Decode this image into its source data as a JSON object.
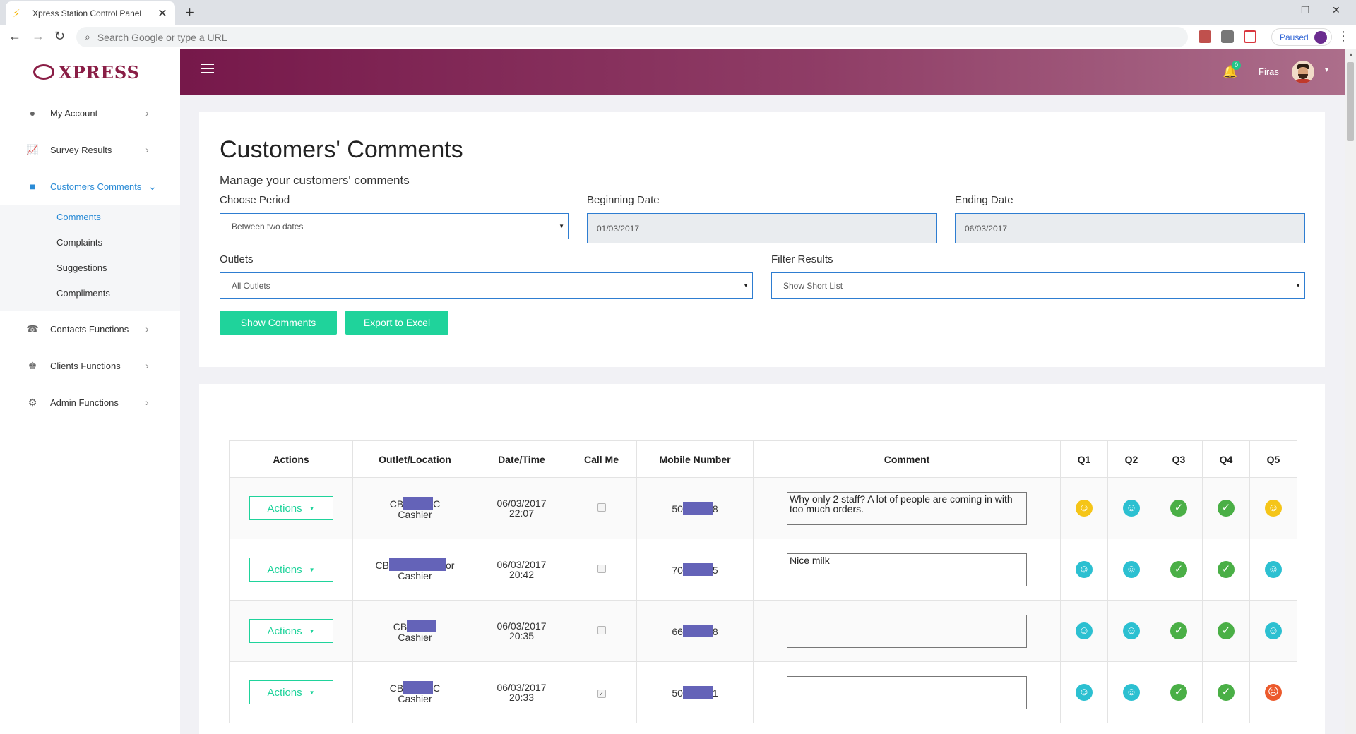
{
  "browser": {
    "tab_title": "Xpress Station Control Panel",
    "tab_close": "✕",
    "new_tab": "+",
    "omnibox_placeholder": "Search Google or type a URL",
    "profile_status": "Paused"
  },
  "sidebar": {
    "logo_text": "XPRESS",
    "items": [
      {
        "label": "My Account",
        "icon": "user-icon"
      },
      {
        "label": "Survey Results",
        "icon": "chart-icon"
      },
      {
        "label": "Customers Comments",
        "icon": "comment-icon",
        "active": true
      },
      {
        "label": "Contacts Functions",
        "icon": "phone-icon"
      },
      {
        "label": "Clients Functions",
        "icon": "chess-king-icon"
      },
      {
        "label": "Admin Functions",
        "icon": "users-cog-icon"
      }
    ],
    "submenu": [
      "Comments",
      "Complaints",
      "Suggestions",
      "Compliments"
    ]
  },
  "header": {
    "notification_count": "0",
    "username": "Firas"
  },
  "filters": {
    "title": "Customers' Comments",
    "subtitle": "Manage your customers' comments",
    "period_label": "Choose Period",
    "period_value": "Between two dates",
    "begin_label": "Beginning Date",
    "begin_value": "01/03/2017",
    "end_label": "Ending Date",
    "end_value": "06/03/2017",
    "outlets_label": "Outlets",
    "outlets_value": "All Outlets",
    "filter_label": "Filter Results",
    "filter_value": "Show Short List",
    "show_button": "Show Comments",
    "export_button": "Export to Excel"
  },
  "table": {
    "headers": [
      "Actions",
      "Outlet/Location",
      "Date/Time",
      "Call Me",
      "Mobile Number",
      "Comment",
      "Q1",
      "Q2",
      "Q3",
      "Q4",
      "Q5"
    ],
    "action_label": "Actions",
    "rows": [
      {
        "outlet_pre": "CB",
        "outlet_post": "C",
        "location": "Cashier",
        "date": "06/03/2017",
        "time": "22:07",
        "call_me": false,
        "mobile_pre": "50",
        "mobile_post": "8",
        "comment": "Why only 2 staff? A lot of people are coming in with too much orders.",
        "ratings": [
          "yellow",
          "teal",
          "green",
          "green",
          "yellow"
        ]
      },
      {
        "outlet_pre": "CB",
        "outlet_post": "or",
        "location": "Cashier",
        "date": "06/03/2017",
        "time": "20:42",
        "call_me": false,
        "mobile_pre": "70",
        "mobile_post": "5",
        "comment": "Nice milk",
        "ratings": [
          "teal",
          "teal",
          "green",
          "green",
          "teal"
        ]
      },
      {
        "outlet_pre": "CB",
        "outlet_post": "",
        "location": "Cashier",
        "date": "06/03/2017",
        "time": "20:35",
        "call_me": false,
        "mobile_pre": "66",
        "mobile_post": "8",
        "comment": "",
        "ratings": [
          "teal",
          "teal",
          "green",
          "green",
          "teal"
        ]
      },
      {
        "outlet_pre": "CB",
        "outlet_post": "C",
        "location": "Cashier",
        "date": "06/03/2017",
        "time": "20:33",
        "call_me": true,
        "mobile_pre": "50",
        "mobile_post": "1",
        "comment": "",
        "ratings": [
          "teal",
          "teal",
          "green",
          "green",
          "red"
        ]
      }
    ]
  },
  "colors": {
    "header_start": "#76184a",
    "header_end": "#ac6e8b",
    "accent_green": "#1fd39b",
    "active_blue": "#2a8bd6",
    "redaction": "#6463b8"
  }
}
